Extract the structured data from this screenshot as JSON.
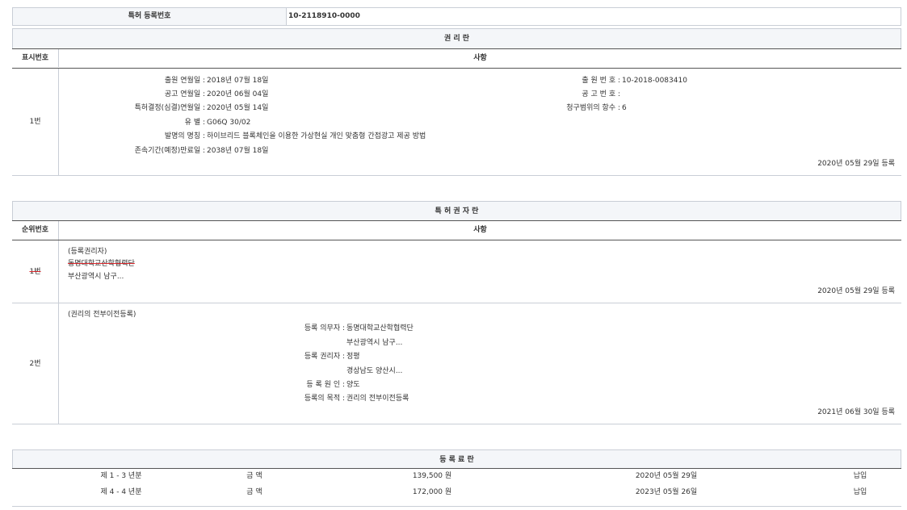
{
  "top_table": {
    "label": "특허 등록번호",
    "value": "10-2118910-0000"
  },
  "rights_section": {
    "title": "권 리 란",
    "col_num": "표시번호",
    "col_content": "사항",
    "row": {
      "num": "1번",
      "left_fields": [
        {
          "label": "출원 연월일 :",
          "value": "2018년 07월 18일"
        },
        {
          "label": "공고 연월일 :",
          "value": "2020년 06월 04일"
        },
        {
          "label": "특허결정(심결)연월일 :",
          "value": "2020년 05월 14일"
        },
        {
          "label": "유 별 :",
          "value": "G06Q 30/02"
        },
        {
          "label": "발명의 명칭 :",
          "value": "하이브리드 블록체인을 이용한 가상현실 개인 맞춤형 간접광고 제공 방법"
        },
        {
          "label": "존속기간(예정)만료일 :",
          "value": "2038년 07월 18일"
        }
      ],
      "right_fields": [
        {
          "label": "출 원 번 호 :",
          "value": "10-2018-0083410"
        },
        {
          "label": "공 고 번 호 :",
          "value": ""
        },
        {
          "label": "청구범위의 항수 :",
          "value": "6"
        }
      ],
      "reg_date": "2020년 05월 29일 등록"
    }
  },
  "holder_section": {
    "title": "특 허 권 자 란",
    "col_num": "순위번호",
    "col_content": "사항",
    "row1": {
      "num": "1번",
      "type": "(등록권리자)",
      "name": "동명대학교산학협력단",
      "address": "부산광역시 남구...",
      "reg_date": "2020년 05월 29일 등록"
    },
    "row2": {
      "num": "2번",
      "type": "(권리의 전부이전등록)",
      "fields": [
        {
          "label": "등록 의무자 :",
          "value": "동명대학교산학협력단"
        },
        {
          "label": "",
          "value": "부산광역시 남구..."
        },
        {
          "label": "등록 권리자 :",
          "value": "정평"
        },
        {
          "label": "",
          "value": "경상남도 양산시..."
        },
        {
          "label": "등 록 원 인 :",
          "value": "양도"
        },
        {
          "label": "등록의 목적 :",
          "value": "권리의 전부이전등록"
        }
      ],
      "reg_date": "2021년 06월 30일 등록"
    }
  },
  "fee_section": {
    "title": "등 록 료 란",
    "rows": [
      {
        "year": "제 1 - 3 년분",
        "amount_label": "금 액",
        "amount": "139,500 원",
        "date": "2020년 05월 29일",
        "status": "납입"
      },
      {
        "year": "제 4 - 4 년분",
        "amount_label": "금 액",
        "amount": "172,000 원",
        "date": "2023년 05월 26일",
        "status": "납입"
      }
    ]
  },
  "colors": {
    "border": "#c9ced6",
    "dark_line": "#555555",
    "header_bg": "#f4f6f9",
    "strike": "#d9262b"
  }
}
